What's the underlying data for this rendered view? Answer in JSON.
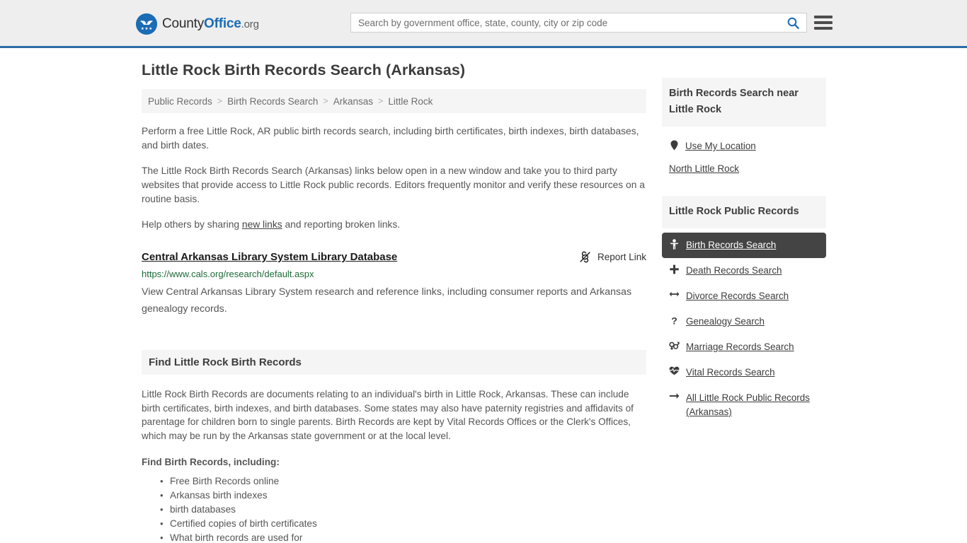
{
  "header": {
    "logo": {
      "name": "county-office-logo",
      "text_county": "County",
      "text_office": "Office",
      "text_org": ".org"
    },
    "search": {
      "placeholder": "Search by government office, state, county, city or zip code",
      "value": "",
      "icon": "search-icon"
    },
    "menu_icon": "hamburger-menu-icon"
  },
  "page": {
    "title": "Little Rock Birth Records Search (Arkansas)"
  },
  "breadcrumb": {
    "items": [
      {
        "label": "Public Records"
      },
      {
        "label": "Birth Records Search"
      },
      {
        "label": "Arkansas"
      },
      {
        "label": "Little Rock"
      }
    ],
    "separator": ">"
  },
  "intro": {
    "p1": "Perform a free Little Rock, AR public birth records search, including birth certificates, birth indexes, birth databases, and birth dates.",
    "p2": "The Little Rock Birth Records Search (Arkansas) links below open in a new window and take you to third party websites that provide access to Little Rock public records. Editors frequently monitor and verify these resources on a routine basis.",
    "p3_before": "Help others by sharing ",
    "p3_link": "new links",
    "p3_after": " and reporting broken links."
  },
  "result": {
    "title": "Central Arkansas Library System Library Database",
    "report_label": "Report Link",
    "report_icon": "broken-link-icon",
    "url": "https://www.cals.org/research/default.aspx",
    "description": "View Central Arkansas Library System research and reference links, including consumer reports and Arkansas genealogy records."
  },
  "section": {
    "heading": "Find Little Rock Birth Records",
    "body": "Little Rock Birth Records are documents relating to an individual's birth in Little Rock, Arkansas. These can include birth certificates, birth indexes, and birth databases. Some states may also have paternity registries and affidavits of parentage for children born to single parents. Birth Records are kept by Vital Records Offices or the Clerk's Offices, which may be run by the Arkansas state government or at the local level.",
    "sub_heading": "Find Birth Records, including:",
    "list": [
      "Free Birth Records online",
      "Arkansas birth indexes",
      "birth databases",
      "Certified copies of birth certificates",
      "What birth records are used for"
    ]
  },
  "sidebar": {
    "near_box": {
      "heading": "Birth Records Search near Little Rock",
      "links": [
        {
          "label": "Use My Location",
          "icon": "map-pin-icon"
        },
        {
          "label": "North Little Rock",
          "icon": "none"
        }
      ]
    },
    "records_box": {
      "heading": "Little Rock Public Records",
      "items": [
        {
          "label": "Birth Records Search",
          "icon": "baby-icon",
          "active": true
        },
        {
          "label": "Death Records Search",
          "icon": "cross-icon",
          "active": false
        },
        {
          "label": "Divorce Records Search",
          "icon": "arrows-horizontal-icon",
          "active": false
        },
        {
          "label": "Genealogy Search",
          "icon": "question-mark-icon",
          "active": false
        },
        {
          "label": "Marriage Records Search",
          "icon": "venus-mars-icon",
          "active": false
        },
        {
          "label": "Vital Records Search",
          "icon": "heartbeat-icon",
          "active": false
        },
        {
          "label": "All Little Rock Public Records (Arkansas)",
          "icon": "arrow-right-icon",
          "active": false
        }
      ]
    }
  },
  "colors": {
    "brand_blue": "#1b6cb5",
    "header_border": "#2c6ca5",
    "header_bg": "#eeeeee",
    "panel_bg": "#f5f5f5",
    "active_bg": "#444444",
    "url_green": "#1d6b37",
    "text": "#555555"
  }
}
